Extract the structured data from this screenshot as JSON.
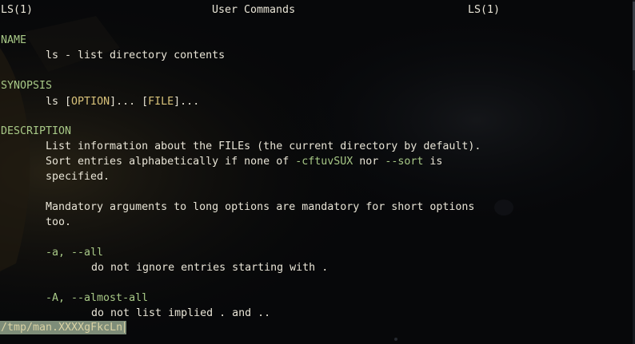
{
  "header": {
    "left": "LS(1)",
    "center": "User Commands",
    "right": "LS(1)"
  },
  "sections": {
    "name_heading": "NAME",
    "name_text": "ls - list directory contents",
    "synopsis_heading": "SYNOPSIS",
    "synopsis": {
      "cmd": "ls ",
      "lbracket1": "[",
      "arg1": "OPTION",
      "rbracket1": "]... ",
      "lbracket2": "[",
      "arg2": "FILE",
      "rbracket2": "]..."
    },
    "description_heading": "DESCRIPTION",
    "desc_line1": "List information about the FILEs (the current directory by default).",
    "desc_line2_a": "Sort entries alphabetically if none of ",
    "desc_line2_opt1": "-cftuvSUX",
    "desc_line2_b": " nor ",
    "desc_line2_opt2": "--sort",
    "desc_line2_c": " is",
    "desc_line3": "specified.",
    "desc_line4": "Mandatory arguments to long options are mandatory for short options",
    "desc_line5": "too."
  },
  "options": [
    {
      "flags": "-a, --all",
      "text": "do not ignore entries starting with ."
    },
    {
      "flags": "-A, --almost-all",
      "text": "do not list implied . and .."
    }
  ],
  "status_line": "/tmp/man.XXXXgFkcLn",
  "colors": {
    "section": "#a8c987",
    "argument": "#d8c27a",
    "text": "#e8e4d6",
    "status_bg": "#7e8d79"
  }
}
